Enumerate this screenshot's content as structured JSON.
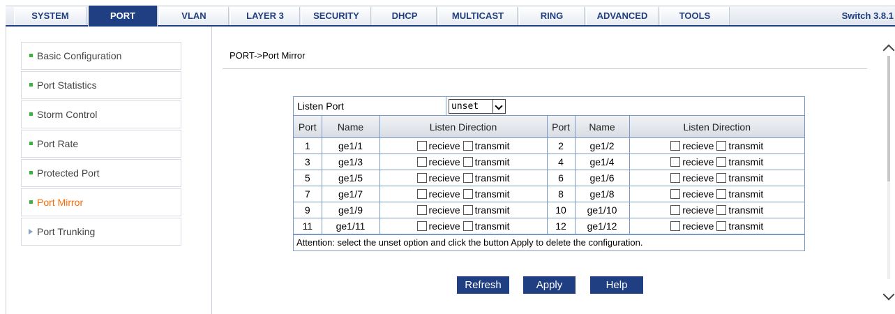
{
  "nav": {
    "tabs": [
      "SYSTEM",
      "PORT",
      "VLAN",
      "LAYER 3",
      "SECURITY",
      "DHCP",
      "MULTICAST",
      "RING",
      "ADVANCED",
      "TOOLS"
    ],
    "active": "PORT",
    "version": "Switch 3.8.1"
  },
  "sidebar": {
    "items": [
      {
        "label": "Basic Configuration"
      },
      {
        "label": "Port Statistics"
      },
      {
        "label": "Storm Control"
      },
      {
        "label": "Port Rate"
      },
      {
        "label": "Protected Port"
      },
      {
        "label": "Port Mirror"
      },
      {
        "label": "Port Trunking"
      }
    ],
    "active": "Port Mirror"
  },
  "main": {
    "breadcrumb": "PORT->Port Mirror",
    "listen_port_label": "Listen Port",
    "listen_port_value": "unset",
    "headers": {
      "port": "Port",
      "name": "Name",
      "direction": "Listen Direction"
    },
    "direction_options": {
      "receive": "recieve",
      "transmit": "transmit"
    },
    "rows": [
      {
        "left": {
          "port": "1",
          "name": "ge1/1"
        },
        "right": {
          "port": "2",
          "name": "ge1/2"
        }
      },
      {
        "left": {
          "port": "3",
          "name": "ge1/3"
        },
        "right": {
          "port": "4",
          "name": "ge1/4"
        }
      },
      {
        "left": {
          "port": "5",
          "name": "ge1/5"
        },
        "right": {
          "port": "6",
          "name": "ge1/6"
        }
      },
      {
        "left": {
          "port": "7",
          "name": "ge1/7"
        },
        "right": {
          "port": "8",
          "name": "ge1/8"
        }
      },
      {
        "left": {
          "port": "9",
          "name": "ge1/9"
        },
        "right": {
          "port": "10",
          "name": "ge1/10"
        }
      },
      {
        "left": {
          "port": "11",
          "name": "ge1/11"
        },
        "right": {
          "port": "12",
          "name": "ge1/12"
        }
      }
    ],
    "attention": "Attention: select the unset option and click the button Apply to delete the configuration.",
    "buttons": {
      "refresh": "Refresh",
      "apply": "Apply",
      "help": "Help"
    }
  },
  "colors": {
    "nav_accent": "#1f3f82",
    "active_side": "#ff6a00",
    "bullet": "#3ab33a"
  }
}
